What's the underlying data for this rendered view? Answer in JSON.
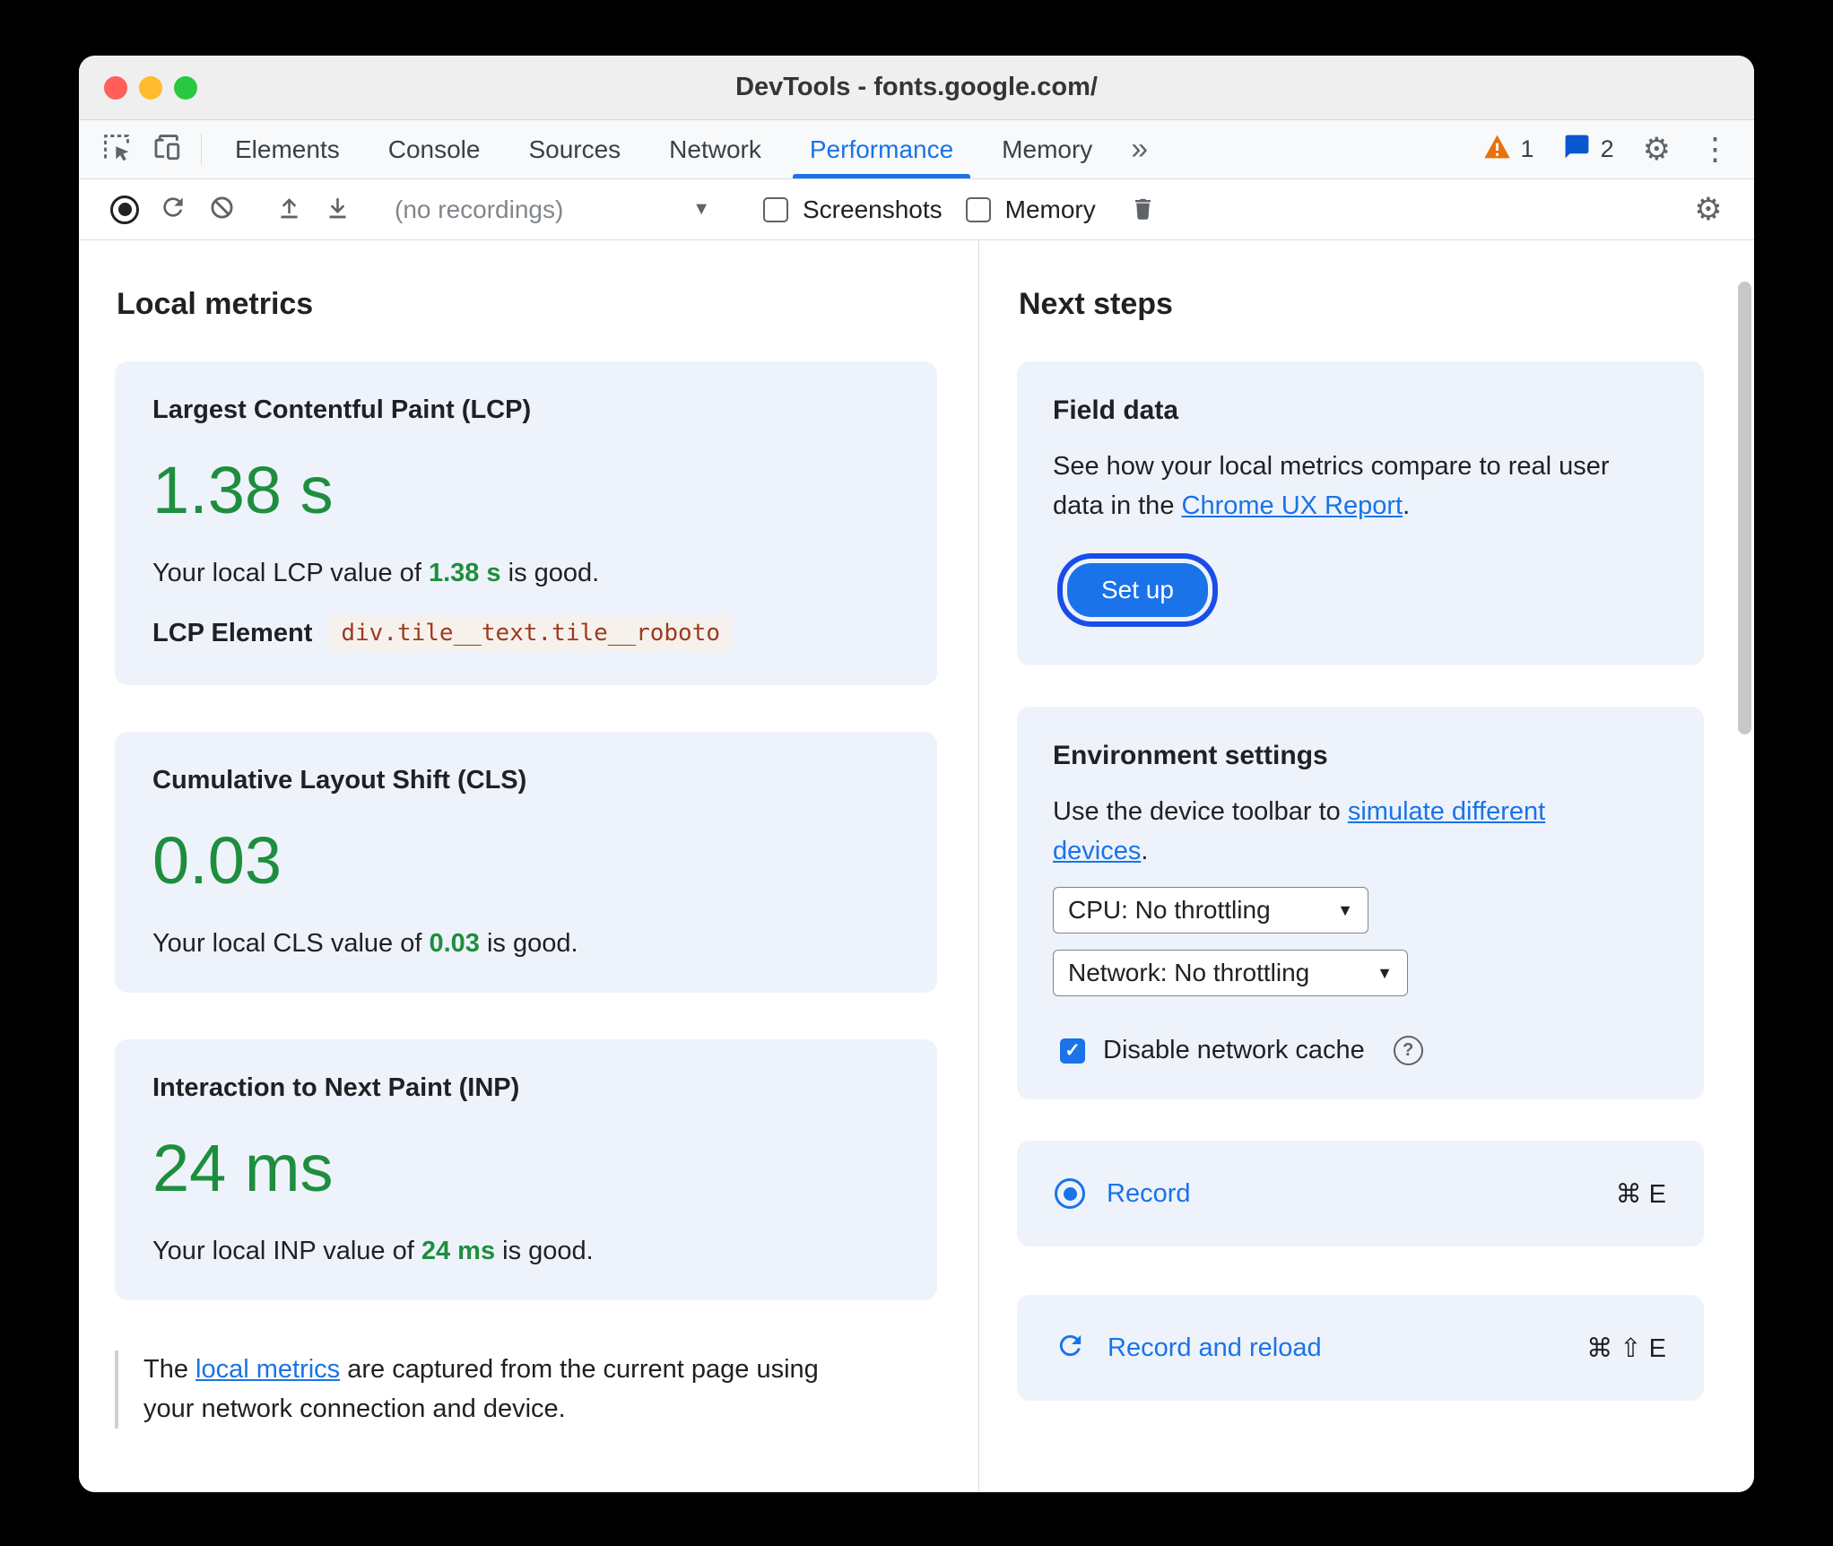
{
  "window": {
    "title": "DevTools - fonts.google.com/"
  },
  "tabbar": {
    "tabs": [
      {
        "label": "Elements"
      },
      {
        "label": "Console"
      },
      {
        "label": "Sources"
      },
      {
        "label": "Network"
      },
      {
        "label": "Performance"
      },
      {
        "label": "Memory"
      }
    ],
    "warning_count": "1",
    "issues_count": "2"
  },
  "toolbar": {
    "recordings_value": "(no recordings)",
    "screenshots_label": "Screenshots",
    "memory_label": "Memory"
  },
  "local_metrics": {
    "heading": "Local metrics",
    "cards": [
      {
        "title": "Largest Contentful Paint (LCP)",
        "value": "1.38 s",
        "desc_prefix": "Your local LCP value of ",
        "desc_value": "1.38 s",
        "desc_suffix": " is good.",
        "element_label": "LCP Element",
        "element_code": "div.tile__text.tile__roboto"
      },
      {
        "title": "Cumulative Layout Shift (CLS)",
        "value": "0.03",
        "desc_prefix": "Your local CLS value of ",
        "desc_value": "0.03",
        "desc_suffix": " is good."
      },
      {
        "title": "Interaction to Next Paint (INP)",
        "value": "24 ms",
        "desc_prefix": "Your local INP value of ",
        "desc_value": "24 ms",
        "desc_suffix": " is good."
      }
    ],
    "note_prefix": "The ",
    "note_link": "local metrics",
    "note_suffix": " are captured from the current page using your network connection and device."
  },
  "next_steps": {
    "heading": "Next steps",
    "field_data": {
      "title": "Field data",
      "desc_prefix": "See how your local metrics compare to real user data in the ",
      "desc_link": "Chrome UX Report",
      "desc_suffix": ".",
      "setup_button": "Set up"
    },
    "environment": {
      "title": "Environment settings",
      "desc_prefix": "Use the device toolbar to ",
      "desc_link": "simulate different devices",
      "desc_suffix": ".",
      "cpu_value": "CPU: No throttling",
      "network_value": "Network: No throttling",
      "cache_label": "Disable network cache"
    },
    "record": {
      "label": "Record",
      "shortcut": "⌘ E"
    },
    "record_reload": {
      "label": "Record and reload",
      "shortcut": "⌘ ⇧ E"
    }
  },
  "icons": {
    "gear": "⚙",
    "kebab": "⋮",
    "more_tabs": "»",
    "dropdown_arrow": "▼",
    "check": "✓",
    "help": "?"
  },
  "colors": {
    "accent_blue": "#1a73e8",
    "good_green": "#1e8e3e",
    "warning_orange": "#e8710a",
    "issues_blue": "#0b57d0",
    "card_background": "#eef3fb",
    "focus_ring_blue": "#1a4de8",
    "lcp_code_red": "#9e3a1e"
  }
}
